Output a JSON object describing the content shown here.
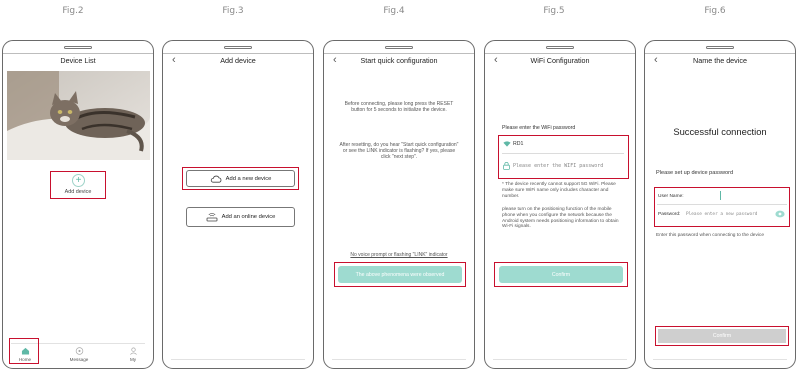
{
  "figures": [
    "Fig.2",
    "Fig.3",
    "Fig.4",
    "Fig.5",
    "Fig.6"
  ],
  "colors": {
    "highlight": "#c8102e",
    "accent_teal": "#9edbd0",
    "accent_teal_dark": "#5fb8a6",
    "disabled_grey": "#cfcfcf"
  },
  "fig2": {
    "title": "Device List",
    "add_device_label": "Add device",
    "tabs": [
      {
        "label": "Home",
        "icon": "home-icon"
      },
      {
        "label": "Message",
        "icon": "message-icon"
      },
      {
        "label": "My",
        "icon": "user-icon"
      }
    ]
  },
  "fig3": {
    "title": "Add device",
    "add_new_device": "Add a new device",
    "add_online_device": "Add an online device",
    "icons": {
      "new": "cloud-icon",
      "online": "router-icon"
    }
  },
  "fig4": {
    "title": "Start quick configuration",
    "para1": "Before connecting, please long press the RESET button for 5 seconds to initialize the device.",
    "para2": "After resetting, do you hear \"Start quick configuration\" or see the LINK indicator is flashing? If yes, please click \"next step\".",
    "no_voice_link": "No voice prompt or flashing \"LINK\" indicator",
    "observed_button": "The above phenomena were observed"
  },
  "fig5": {
    "title": "WiFi Configuration",
    "enter_password_label": "Please enter the WiFi password",
    "wifi_name": "RD1",
    "password_placeholder": "Please enter the WIFI password",
    "note1": "* The device recently cannot support 5G WiFi. Please make sure WiFi name only includes character and number.",
    "note2": "please turn on the positioning function of the mobile phone when you configure the network because the Android system needs positioning information to obtain Wi-Fi signals.",
    "confirm": "Confirm"
  },
  "fig6": {
    "title": "Name the device",
    "success": "Successful connection",
    "setup_label": "Please set up device password",
    "username_label": "User Name:",
    "password_label": "Password:",
    "password_placeholder": "Please enter a new password",
    "hint": "Enter this password when connecting to the device",
    "confirm": "Confirm"
  }
}
